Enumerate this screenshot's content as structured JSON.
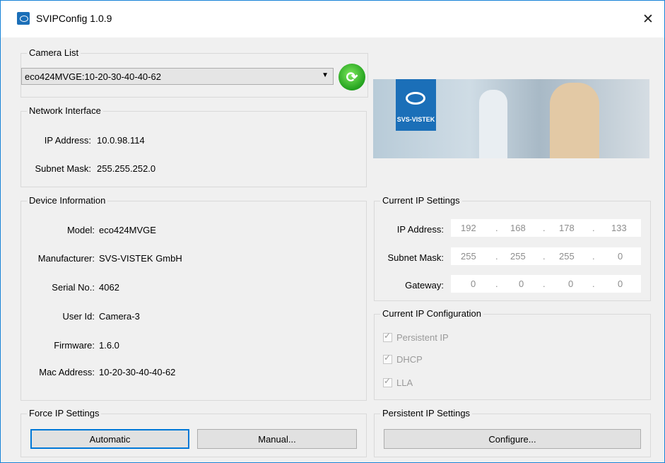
{
  "window": {
    "title": "SVIPConfig 1.0.9",
    "close_glyph": "✕"
  },
  "camera_list": {
    "group_label": "Camera List",
    "selected": "eco424MVGE:10-20-30-40-40-62",
    "refresh_glyph": "⟳"
  },
  "network_interface": {
    "group_label": "Network Interface",
    "ip_label": "IP Address:",
    "ip_value": "10.0.98.114",
    "mask_label": "Subnet Mask:",
    "mask_value": "255.255.252.0"
  },
  "banner": {
    "logo_text": "SVS-VISTEK"
  },
  "device_info": {
    "group_label": "Device Information",
    "rows": [
      {
        "label": "Model:",
        "value": "eco424MVGE"
      },
      {
        "label": "Manufacturer:",
        "value": "SVS-VISTEK GmbH"
      },
      {
        "label": "Serial No.:",
        "value": "4062"
      },
      {
        "label": "User Id:",
        "value": "Camera-3"
      },
      {
        "label": "Firmware:",
        "value": "1.6.0"
      },
      {
        "label": "Mac Address:",
        "value": "10-20-30-40-40-62"
      }
    ]
  },
  "current_ip": {
    "group_label": "Current IP Settings",
    "dot": ".",
    "rows": [
      {
        "label": "IP Address:",
        "octets": [
          "192",
          "168",
          "178",
          "133"
        ]
      },
      {
        "label": "Subnet Mask:",
        "octets": [
          "255",
          "255",
          "255",
          "0"
        ]
      },
      {
        "label": "Gateway:",
        "octets": [
          "0",
          "0",
          "0",
          "0"
        ]
      }
    ]
  },
  "ip_config": {
    "group_label": "Current IP Configuration",
    "options": [
      {
        "label": "Persistent IP",
        "checked": true
      },
      {
        "label": "DHCP",
        "checked": true
      },
      {
        "label": "LLA",
        "checked": true
      }
    ]
  },
  "force_ip": {
    "group_label": "Force IP Settings",
    "automatic_label": "Automatic",
    "manual_label": "Manual..."
  },
  "persistent_ip": {
    "group_label": "Persistent IP Settings",
    "configure_label": "Configure..."
  },
  "colors": {
    "accent": "#0078d7",
    "brand": "#1b6fb8",
    "refresh": "#23a11e"
  }
}
